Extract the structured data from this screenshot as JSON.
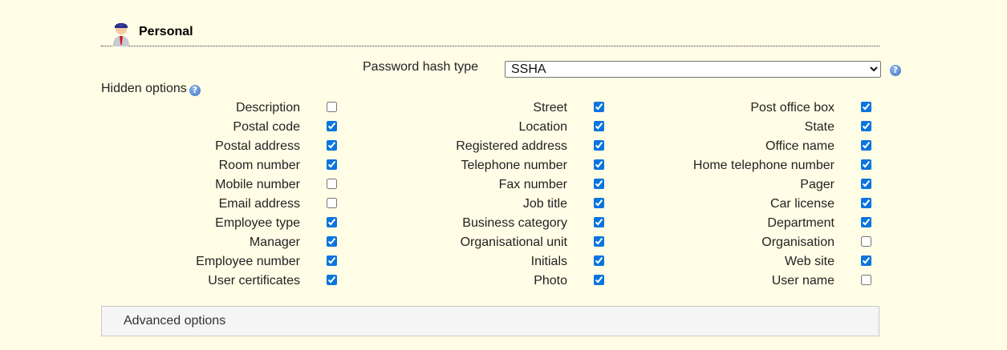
{
  "section": {
    "title": "Personal",
    "icon": "user-icon"
  },
  "password_hash": {
    "label": "Password hash type",
    "selected": "SSHA"
  },
  "hidden_options": {
    "label": "Hidden options",
    "columns": [
      [
        {
          "label": "Description",
          "checked": false
        },
        {
          "label": "Postal code",
          "checked": true
        },
        {
          "label": "Postal address",
          "checked": true
        },
        {
          "label": "Room number",
          "checked": true
        },
        {
          "label": "Mobile number",
          "checked": false
        },
        {
          "label": "Email address",
          "checked": false
        },
        {
          "label": "Employee type",
          "checked": true
        },
        {
          "label": "Manager",
          "checked": true
        },
        {
          "label": "Employee number",
          "checked": true
        },
        {
          "label": "User certificates",
          "checked": true
        }
      ],
      [
        {
          "label": "Street",
          "checked": true
        },
        {
          "label": "Location",
          "checked": true
        },
        {
          "label": "Registered address",
          "checked": true
        },
        {
          "label": "Telephone number",
          "checked": true
        },
        {
          "label": "Fax number",
          "checked": true
        },
        {
          "label": "Job title",
          "checked": true
        },
        {
          "label": "Business category",
          "checked": true
        },
        {
          "label": "Organisational unit",
          "checked": true
        },
        {
          "label": "Initials",
          "checked": true
        },
        {
          "label": "Photo",
          "checked": true
        }
      ],
      [
        {
          "label": "Post office box",
          "checked": true
        },
        {
          "label": "State",
          "checked": true
        },
        {
          "label": "Office name",
          "checked": true
        },
        {
          "label": "Home telephone number",
          "checked": true
        },
        {
          "label": "Pager",
          "checked": true
        },
        {
          "label": "Car license",
          "checked": true
        },
        {
          "label": "Department",
          "checked": true
        },
        {
          "label": "Organisation",
          "checked": false
        },
        {
          "label": "Web site",
          "checked": true
        },
        {
          "label": "User name",
          "checked": false
        }
      ]
    ]
  },
  "advanced": {
    "label": "Advanced options"
  },
  "colors": {
    "background": "#fffde6",
    "checkbox_accent": "#0b74de"
  }
}
